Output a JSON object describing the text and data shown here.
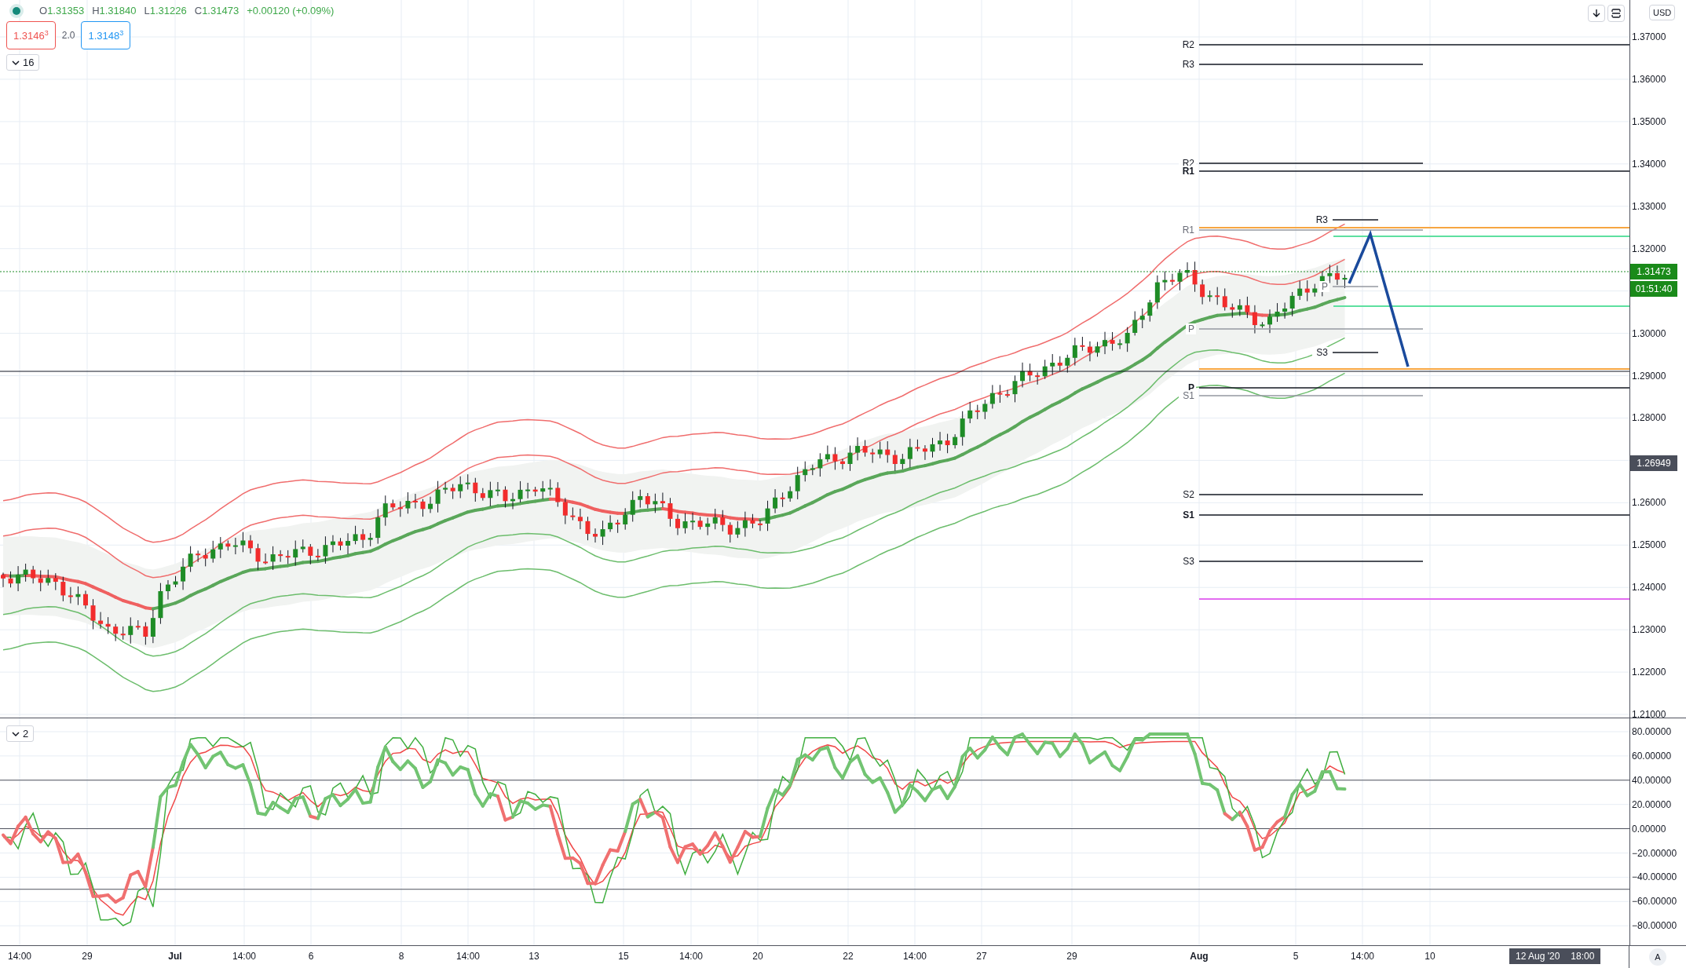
{
  "legend": {
    "ohlc": [
      {
        "label": "O",
        "value": "1.31353"
      },
      {
        "label": "H",
        "value": "1.31840"
      },
      {
        "label": "L",
        "value": "1.31226"
      },
      {
        "label": "C",
        "value": "1.31473"
      }
    ],
    "change": "+0.00120 (+0.09%)"
  },
  "quote": {
    "bid": "1.3146$^{3}$",
    "spread": "2.0",
    "ask": "1.3148$^{3}$"
  },
  "indicator_toggle": "16",
  "oscillator_toggle": "2",
  "currency_button": "USD",
  "price_axis": {
    "ticks": [
      "1.37000",
      "1.36000",
      "1.35000",
      "1.34000",
      "1.33000",
      "1.32000",
      "1.30000",
      "1.29000",
      "1.28000",
      "1.26000",
      "1.25000",
      "1.24000",
      "1.23000",
      "1.22000",
      "1.21000"
    ]
  },
  "last_price": "1.31473",
  "countdown": "01:51:40",
  "crosshair_price": "1.26949",
  "pivot_lines": [
    {
      "label": "R2",
      "kind": "plain"
    },
    {
      "label": "R3",
      "kind": "plain"
    },
    {
      "label": "R2",
      "kind": "plain"
    },
    {
      "label": "R1",
      "kind": "bold"
    },
    {
      "label": "R3",
      "kind": "plain"
    },
    {
      "label": "R1",
      "kind": "faint"
    },
    {
      "label": "P",
      "kind": "faint"
    },
    {
      "label": "P",
      "kind": "faint"
    },
    {
      "label": "S3",
      "kind": "plain"
    },
    {
      "label": "P",
      "kind": "bold"
    },
    {
      "label": "S1",
      "kind": "faint"
    },
    {
      "label": "S2",
      "kind": "plain"
    },
    {
      "label": "S1",
      "kind": "bold"
    },
    {
      "label": "S3",
      "kind": "plain"
    }
  ],
  "oscillator_axis": {
    "ticks": [
      "80.00000",
      "60.00000",
      "40.00000",
      "20.00000",
      "0.00000",
      "−20.00000",
      "−40.00000",
      "−60.00000",
      "−80.00000"
    ]
  },
  "time_axis": {
    "labels": [
      {
        "text": "14:00",
        "kind": "tick"
      },
      {
        "text": "29",
        "kind": "tick"
      },
      {
        "text": "Jul",
        "kind": "month"
      },
      {
        "text": "14:00",
        "kind": "tick"
      },
      {
        "text": "6",
        "kind": "tick"
      },
      {
        "text": "8",
        "kind": "tick"
      },
      {
        "text": "14:00",
        "kind": "tick"
      },
      {
        "text": "13",
        "kind": "tick"
      },
      {
        "text": "15",
        "kind": "tick"
      },
      {
        "text": "14:00",
        "kind": "tick"
      },
      {
        "text": "20",
        "kind": "tick"
      },
      {
        "text": "22",
        "kind": "tick"
      },
      {
        "text": "14:00",
        "kind": "tick"
      },
      {
        "text": "27",
        "kind": "tick"
      },
      {
        "text": "29",
        "kind": "tick"
      },
      {
        "text": "Aug",
        "kind": "month"
      },
      {
        "text": "5",
        "kind": "tick"
      },
      {
        "text": "14:00",
        "kind": "tick"
      },
      {
        "text": "10",
        "kind": "tick"
      }
    ],
    "tooltip": {
      "date": "12 Aug '20",
      "time": "18:00"
    }
  },
  "auto_scale_button": "A"
}
